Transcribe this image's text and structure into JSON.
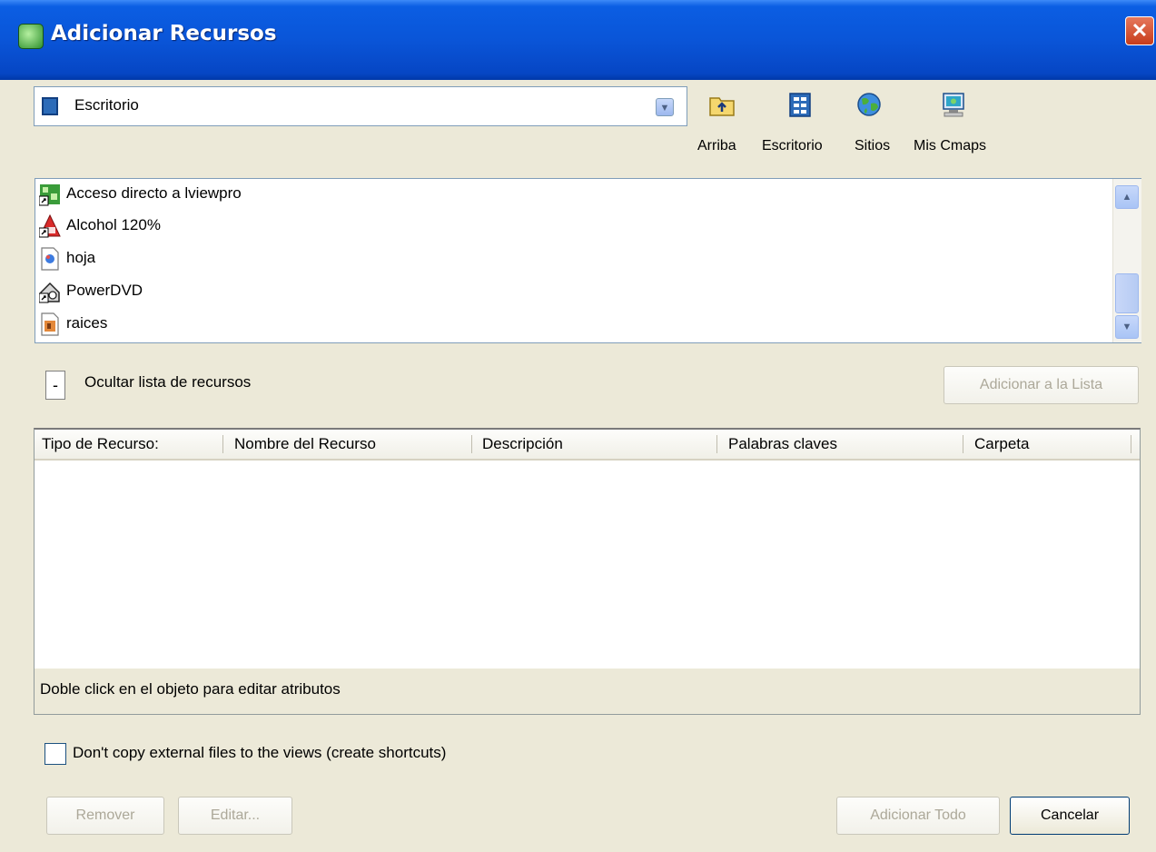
{
  "window": {
    "title": "Adicionar Recursos",
    "close": "✕"
  },
  "location": {
    "value": "Escritorio",
    "arrow": "▼"
  },
  "toolbar": [
    {
      "id": "arriba",
      "label": "Arriba",
      "icon": "folder-up-icon"
    },
    {
      "id": "escritorio",
      "label": "Escritorio",
      "icon": "desktop-icon"
    },
    {
      "id": "sitios",
      "label": "Sitios",
      "icon": "globe-icon"
    },
    {
      "id": "mis-cmaps",
      "label": "Mis Cmaps",
      "icon": "computer-icon"
    }
  ],
  "files": [
    {
      "name": "Acceso directo a lviewpro",
      "icon": "shortcut-app-icon"
    },
    {
      "name": "Alcohol 120%",
      "icon": "alcohol-icon"
    },
    {
      "name": "hoja",
      "icon": "document-icon"
    },
    {
      "name": "PowerDVD",
      "icon": "powerdvd-icon"
    },
    {
      "name": "raices",
      "icon": "image-file-icon"
    }
  ],
  "scroll": {
    "up": "▲",
    "down": "▼"
  },
  "hide_list": {
    "symbol": "-",
    "label": "Ocultar lista de recursos"
  },
  "add_to_list": "Adicionar a la Lista",
  "table": {
    "columns": [
      "Tipo de Recurso:",
      "Nombre del Recurso",
      "Descripción",
      "Palabras claves",
      "Carpeta"
    ],
    "hint": "Doble click en el objeto para editar atributos"
  },
  "shortcut_option": {
    "label": "Don't copy external files to the views (create shortcuts)",
    "checked": false
  },
  "buttons": {
    "remove": "Remover",
    "edit": "Editar...",
    "add_all": "Adicionar Todo",
    "cancel": "Cancelar"
  }
}
